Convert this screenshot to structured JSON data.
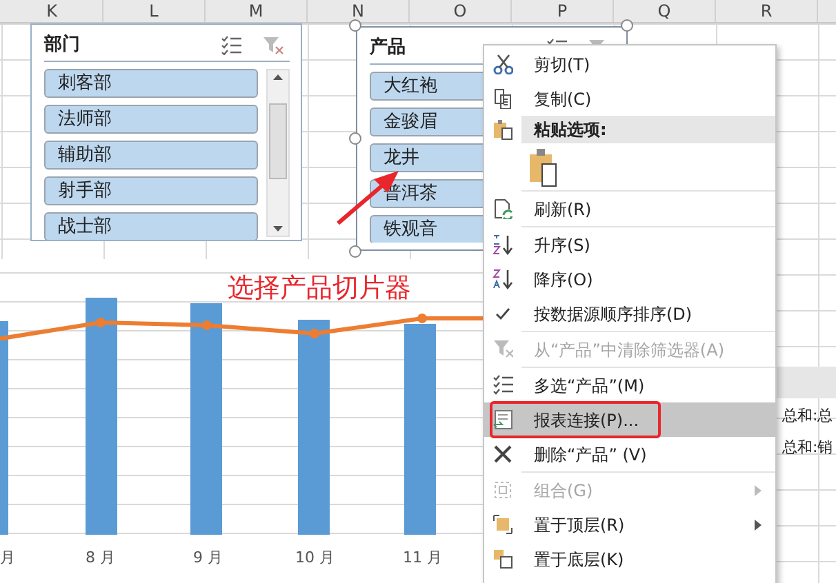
{
  "columns": [
    "K",
    "L",
    "M",
    "N",
    "O",
    "P",
    "Q",
    "R"
  ],
  "slicers": [
    {
      "title": "部门",
      "selected": false,
      "scrollbar": true,
      "items": [
        "刺客部",
        "法师部",
        "辅助部",
        "射手部",
        "战士部"
      ]
    },
    {
      "title": "产品",
      "selected": true,
      "scrollbar": false,
      "items": [
        "大红袍",
        "金骏眉",
        "龙井",
        "普洱茶",
        "铁观音"
      ]
    }
  ],
  "annotation": {
    "text": "选择产品切片器"
  },
  "chart": {
    "labels": [
      "月",
      "8 月",
      "9 月",
      "10 月",
      "11 月"
    ]
  },
  "cells": [
    "总和:总",
    "总和:销"
  ],
  "context_menu": {
    "items": [
      {
        "kind": "item",
        "label": "剪切(T)",
        "disabled": false,
        "selected": false,
        "submenu": false,
        "checked": false
      },
      {
        "kind": "item",
        "label": "复制(C)",
        "disabled": false,
        "selected": false,
        "submenu": false,
        "checked": false
      },
      {
        "kind": "header",
        "label": "粘贴选项:"
      },
      {
        "kind": "paste"
      },
      {
        "kind": "separator"
      },
      {
        "kind": "item",
        "label": "刷新(R)",
        "disabled": false,
        "selected": false,
        "submenu": false,
        "checked": false
      },
      {
        "kind": "separator"
      },
      {
        "kind": "item",
        "label": "升序(S)",
        "disabled": false,
        "selected": false,
        "submenu": false,
        "checked": false
      },
      {
        "kind": "item",
        "label": "降序(O)",
        "disabled": false,
        "selected": false,
        "submenu": false,
        "checked": false
      },
      {
        "kind": "item",
        "label": "按数据源顺序排序(D)",
        "disabled": false,
        "selected": false,
        "submenu": false,
        "checked": true
      },
      {
        "kind": "separator"
      },
      {
        "kind": "item",
        "label": "从“产品”中清除筛选器(A)",
        "disabled": true,
        "selected": false,
        "submenu": false,
        "checked": false
      },
      {
        "kind": "separator"
      },
      {
        "kind": "item",
        "label": "多选“产品”(M)",
        "disabled": false,
        "selected": false,
        "submenu": false,
        "checked": false
      },
      {
        "kind": "item",
        "label": "报表连接(P)...",
        "disabled": false,
        "selected": true,
        "submenu": false,
        "checked": false
      },
      {
        "kind": "item",
        "label": "删除“产品” (V)",
        "disabled": false,
        "selected": false,
        "submenu": false,
        "checked": false
      },
      {
        "kind": "separator"
      },
      {
        "kind": "item",
        "label": "组合(G)",
        "disabled": true,
        "selected": false,
        "submenu": true,
        "checked": false
      },
      {
        "kind": "item",
        "label": "置于顶层(R)",
        "disabled": false,
        "selected": false,
        "submenu": true,
        "checked": false
      },
      {
        "kind": "item",
        "label": "置于底层(K)",
        "disabled": false,
        "selected": false,
        "submenu": false,
        "checked": false
      }
    ]
  }
}
